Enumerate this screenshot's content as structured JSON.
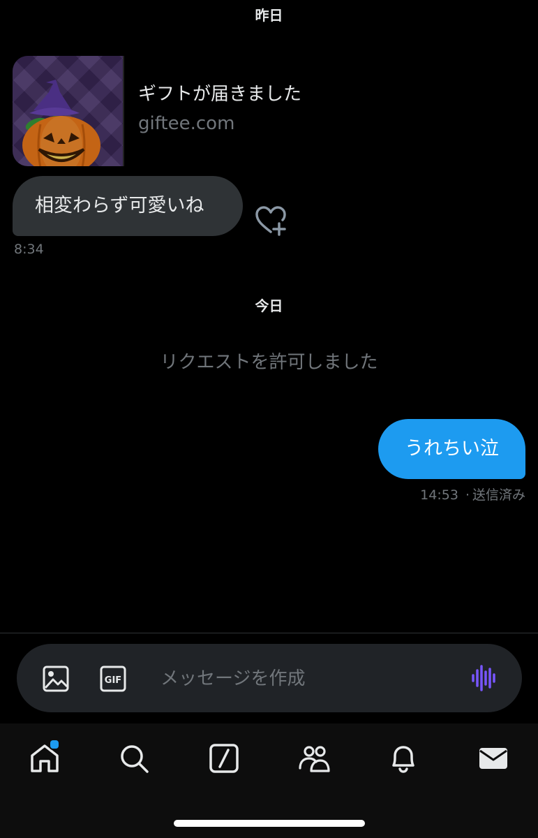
{
  "conversation": {
    "date_yesterday": "昨日",
    "gift_card": {
      "title": "ギフトが届きました",
      "domain": "giftee.com",
      "thumbnail_icon": "halloween-pumpkin-image"
    },
    "incoming_message": {
      "text": "相変わらず可愛いね",
      "time": "8:34",
      "reaction_icon": "heart-plus-icon"
    },
    "date_today": "今日",
    "system_message": "リクエストを許可しました",
    "outgoing_message": {
      "text": "うれちい泣",
      "time": "14:53",
      "separator": "·",
      "status": "送信済み"
    }
  },
  "composer": {
    "placeholder": "メッセージを作成",
    "image_icon": "image-icon",
    "gif_label": "GIF",
    "voice_icon": "voice-waveform-icon"
  },
  "tabbar": {
    "items": [
      {
        "name": "home",
        "icon": "home-icon",
        "has_notification_dot": true
      },
      {
        "name": "search",
        "icon": "search-icon"
      },
      {
        "name": "grok",
        "icon": "grok-icon"
      },
      {
        "name": "communities",
        "icon": "communities-icon"
      },
      {
        "name": "notifications",
        "icon": "bell-icon"
      },
      {
        "name": "messages",
        "icon": "mail-icon"
      }
    ]
  },
  "colors": {
    "background": "#000000",
    "incoming_bubble": "#2f3336",
    "outgoing_bubble": "#1d9bf0",
    "secondary_text": "#71767b",
    "voice_accent": "#7856ff"
  }
}
